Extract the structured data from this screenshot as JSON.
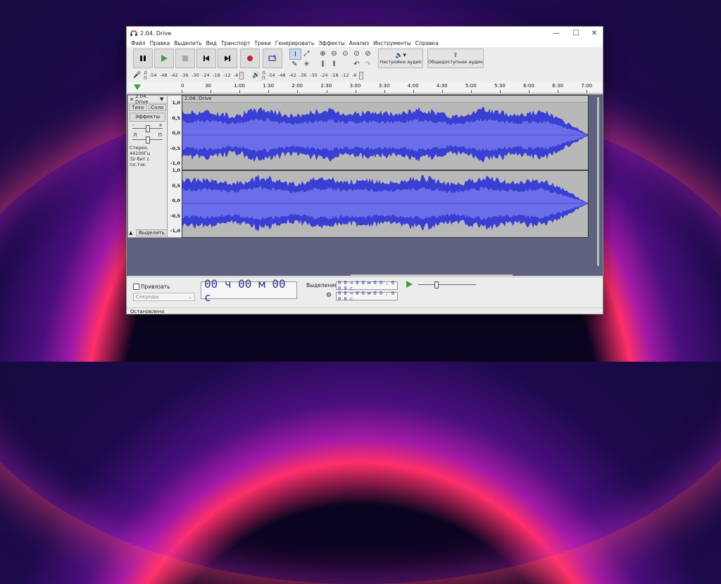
{
  "window": {
    "title": "2.04. Drive"
  },
  "menu": [
    "Файл",
    "Правка",
    "Выделить",
    "Вид",
    "Транспорт",
    "Треки",
    "Генерировать",
    "Эффекты",
    "Анализ",
    "Инструменты",
    "Справка"
  ],
  "toolbar": {
    "audio_setup_label": "Настройки аудио",
    "share_audio_label": "Общедоступное аудио"
  },
  "meters": {
    "record_scale": [
      "-54",
      "-48",
      "-42",
      "-36",
      "-30",
      "-24",
      "-18",
      "-12",
      "-6"
    ],
    "play_scale": [
      "-54",
      "-48",
      "-42",
      "-36",
      "-30",
      "-24",
      "-18",
      "-12",
      "-6"
    ],
    "lr_record": [
      "Л",
      "П"
    ],
    "lr_play": [
      "Л",
      "П"
    ]
  },
  "ruler": {
    "ticks": [
      "0",
      "30",
      "1:00",
      "1:30",
      "2:00",
      "2:30",
      "3:00",
      "3:30",
      "4:00",
      "4:30",
      "5:00",
      "5:30",
      "6:00",
      "6:30",
      "7:00"
    ]
  },
  "track": {
    "name": "2.04. Drive",
    "clip_name": "2.04. Drive",
    "mute_label": "Тихо",
    "solo_label": "Соло",
    "effects_label": "Эффекты",
    "gain_minus": "-",
    "gain_plus": "+",
    "pan_left": "Л",
    "pan_right": "П",
    "info_line1": "Стерео, 44100Гц",
    "info_line2": "32-бит с пл.тчк.",
    "select_label": "Выделить",
    "scale_top": [
      "1,0",
      "0,5",
      "0,0",
      "-0,5",
      "-1,0"
    ],
    "scale_bottom": [
      "1,0",
      "0,5",
      "0,0",
      "-0,5",
      "-1,0"
    ]
  },
  "selection_bar": {
    "snap_label": "Привязать",
    "unit_value": "Секунды",
    "time_value": "00 ч 00 м 00 с",
    "selection_label": "Выделение",
    "sel_start": "0 0 ч 0 0 м 0 0 , 0 0 0 с",
    "sel_end": "0 0 ч 0 0 м 0 0 , 0 0 0 с"
  },
  "status": {
    "text": "Остановлено"
  },
  "colors": {
    "waveform": "#3a3fd4",
    "waveform_rms": "#6a6ee8",
    "accent_play": "#3ca13c",
    "record": "#c0282d"
  }
}
